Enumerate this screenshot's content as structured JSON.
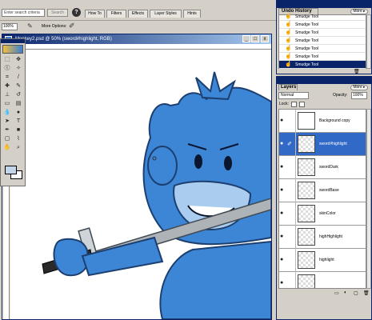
{
  "options_bar": {
    "search_placeholder": "Enter search criteria",
    "search_button": "Search",
    "help_icon": "help-icon",
    "tabs": [
      "How To",
      "Filters",
      "Effects",
      "Layer Styles",
      "Hints"
    ],
    "zoom_value": "100%",
    "more_options_label": "More Options:"
  },
  "document": {
    "title": "Monkey2.psd @ 50% (sword#highlight, RGB)",
    "buttons": [
      "_",
      "□",
      "x"
    ]
  },
  "history": {
    "tab_label": "Undo History",
    "more_label": "More ▸",
    "items": [
      "Smudge Tool",
      "Smudge Tool",
      "Smudge Tool",
      "Smudge Tool",
      "Smudge Tool",
      "Smudge Tool",
      "Smudge Tool"
    ],
    "selected_index": 6
  },
  "layers": {
    "tab_label": "Layers",
    "more_label": "More ▸",
    "blend_mode": "Normal",
    "opacity_label": "Opacity:",
    "opacity_value": "100%",
    "lock_label": "Lock:",
    "items": [
      {
        "name": "Background copy",
        "selected": false
      },
      {
        "name": "sword#highlight",
        "selected": true
      },
      {
        "name": "swordDark",
        "selected": false
      },
      {
        "name": "swordBase",
        "selected": false
      },
      {
        "name": "skinColor",
        "selected": false
      },
      {
        "name": "highHighlight",
        "selected": false
      },
      {
        "name": "highlight",
        "selected": false
      },
      {
        "name": "",
        "selected": false
      }
    ]
  },
  "colors": {
    "accent": "#0a246a",
    "monkey_blue": "#3d86d6",
    "sword_gray": "#aeb3b7"
  }
}
